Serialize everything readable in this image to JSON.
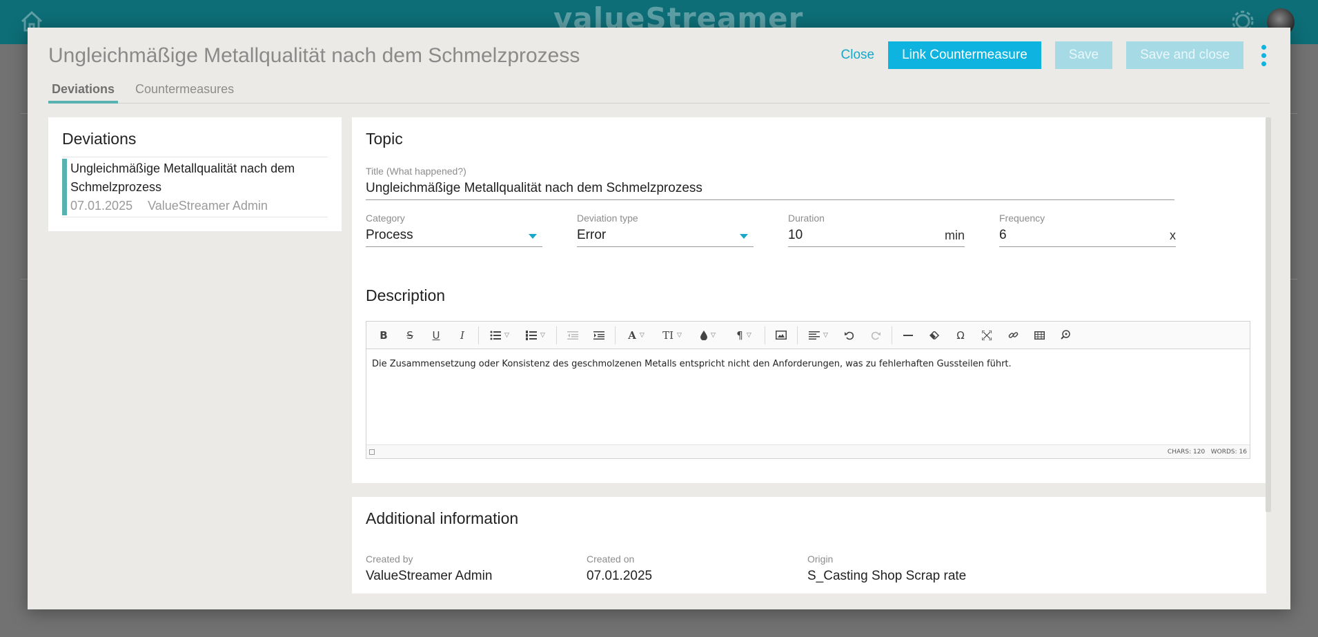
{
  "app": {
    "logo": "valueStreamer"
  },
  "modal": {
    "title": "Ungleichmäßige Metallqualität nach dem Schmelzprozess",
    "actions": {
      "close": "Close",
      "link_countermeasure": "Link Countermeasure",
      "save": "Save",
      "save_and_close": "Save and close"
    },
    "tabs": [
      {
        "label": "Deviations"
      },
      {
        "label": "Countermeasures"
      }
    ]
  },
  "deviations_panel": {
    "heading": "Deviations",
    "items": [
      {
        "title": "Ungleichmäßige Metallqualität nach dem Schmelzprozess",
        "date": "07.01.2025",
        "author": "ValueStreamer Admin"
      }
    ]
  },
  "topic": {
    "heading": "Topic",
    "title_label": "Title (What happened?)",
    "title_value": "Ungleichmäßige Metallqualität nach dem Schmelzprozess",
    "category_label": "Category",
    "category_value": "Process",
    "deviation_type_label": "Deviation type",
    "deviation_type_value": "Error",
    "duration_label": "Duration",
    "duration_value": "10",
    "duration_unit": "min",
    "frequency_label": "Frequency",
    "frequency_value": "6",
    "frequency_unit": "x"
  },
  "description": {
    "heading": "Description",
    "text": "Die Zusammensetzung oder Konsistenz des geschmolzenen Metalls entspricht nicht den Anforderungen, was zu fehlerhaften Gussteilen führt.",
    "chars": "CHARS: 120",
    "words": "WORDS: 16",
    "toolbar": {
      "bold": "B",
      "strike": "S",
      "underline": "U",
      "italic": "I",
      "font": "A",
      "size": "TI",
      "paragraph": "¶",
      "special_char": "Ω"
    }
  },
  "additional": {
    "heading": "Additional information",
    "created_by_label": "Created by",
    "created_by_value": "ValueStreamer Admin",
    "created_on_label": "Created on",
    "created_on_value": "07.01.2025",
    "origin_label": "Origin",
    "origin_value": "S_Casting Shop Scrap rate"
  },
  "colors": {
    "accent": "#0fb3df",
    "header": "#0d6e77",
    "tab_indicator": "#58b3b0"
  }
}
